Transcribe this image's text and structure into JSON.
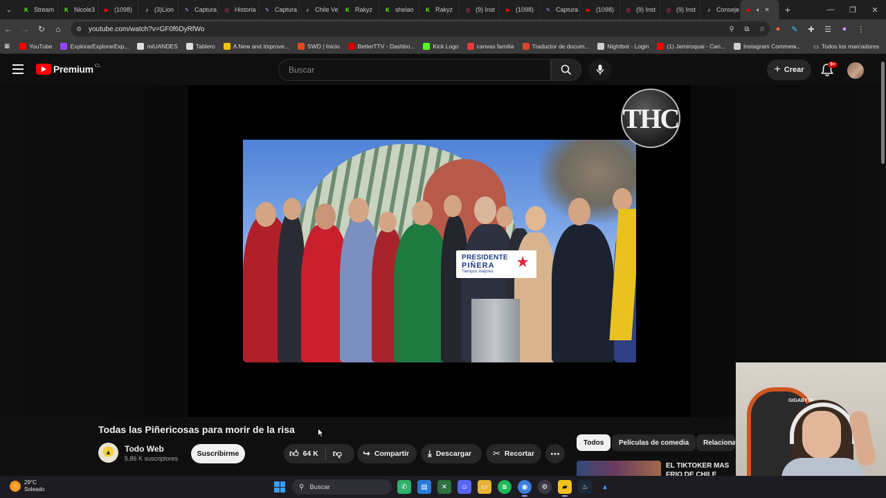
{
  "browser": {
    "tabs": [
      {
        "label": "Stream",
        "icon": "kick-icon",
        "color": "#53fc18"
      },
      {
        "label": "Nicole3",
        "icon": "kick-icon",
        "color": "#53fc18"
      },
      {
        "label": "(1098)",
        "icon": "youtube-icon",
        "color": "#ff0000"
      },
      {
        "label": "(3)Lion",
        "icon": "tiktok-icon",
        "color": "#ffffff"
      },
      {
        "label": "Captura",
        "icon": "pen-icon",
        "color": "#b28cff"
      },
      {
        "label": "Historia",
        "icon": "instagram-icon",
        "color": "#e1306c"
      },
      {
        "label": "Captura",
        "icon": "pen-icon",
        "color": "#b28cff"
      },
      {
        "label": "Chile Ve",
        "icon": "tiktok-icon",
        "color": "#ffffff"
      },
      {
        "label": "Rakyz",
        "icon": "kick-icon",
        "color": "#53fc18"
      },
      {
        "label": "shelao",
        "icon": "kick-icon",
        "color": "#53fc18"
      },
      {
        "label": "Rakyz",
        "icon": "kick-icon",
        "color": "#53fc18"
      },
      {
        "label": "(9) Inst",
        "icon": "instagram-icon",
        "color": "#e1306c"
      },
      {
        "label": "(1098)",
        "icon": "youtube-icon",
        "color": "#ff0000"
      },
      {
        "label": "Captura",
        "icon": "pen-icon",
        "color": "#b28cff"
      },
      {
        "label": "(1098)",
        "icon": "youtube-icon",
        "color": "#ff0000"
      },
      {
        "label": "(9) Inst",
        "icon": "instagram-icon",
        "color": "#e1306c"
      },
      {
        "label": "(9) Inst",
        "icon": "instagram-icon",
        "color": "#e1306c"
      },
      {
        "label": "Conseje",
        "icon": "tiktok-icon",
        "color": "#ffffff"
      }
    ],
    "url": "youtube.com/watch?v=GF0f6DyRfWo",
    "bookmarks": [
      {
        "label": "YouTube",
        "color": "#ff0000"
      },
      {
        "label": "ExplorarExplorarExp...",
        "color": "#9146ff"
      },
      {
        "label": "miUANDES",
        "color": "#dddddd"
      },
      {
        "label": "Tablero",
        "color": "#dddddd"
      },
      {
        "label": "A New and Improve...",
        "color": "#f2c200"
      },
      {
        "label": "SWD | Inicio",
        "color": "#e64a19"
      },
      {
        "label": "BetterTTV - Dashbo...",
        "color": "#d50000"
      },
      {
        "label": "Kick Logo",
        "color": "#53fc18"
      },
      {
        "label": "canvas familia",
        "color": "#e13b3b"
      },
      {
        "label": "Traductor de docum...",
        "color": "#d9442c"
      },
      {
        "label": "Nightbot - Login",
        "color": "#cfcfcf"
      },
      {
        "label": "(1) Jamiroquai - Can...",
        "color": "#ff0000"
      },
      {
        "label": "Instagram Commen...",
        "color": "#cfcfcf"
      }
    ],
    "all_bookmarks": "Todos los marcadores"
  },
  "header": {
    "logo": "Premium",
    "country": "CL",
    "search_placeholder": "Buscar",
    "create_label": "Crear",
    "notifications_badge": "9+"
  },
  "video": {
    "watermark": "THC",
    "sign_line1": "PRESIDENTE",
    "sign_line2": "PIÑERA",
    "sign_line3": "Tiempos mejores",
    "title": "Todas las Piñericosas para morir de la risa",
    "channel": "Todo Web",
    "subscribers": "5,86 K suscriptores",
    "subscribe_label": "Suscribirme",
    "likes": "64 K",
    "share_label": "Compartir",
    "download_label": "Descargar",
    "clip_label": "Recortar"
  },
  "chips": [
    "Todos",
    "Películas de comedia",
    "Relacionado"
  ],
  "recommendation": {
    "title": "EL TIKTOKER MAS FRIO DE CHILE"
  },
  "webcam": {
    "brand_text": "GIGABYTE"
  },
  "taskbar": {
    "temperature": "29°C",
    "weather": "Soleado",
    "search_label": "Buscar"
  }
}
